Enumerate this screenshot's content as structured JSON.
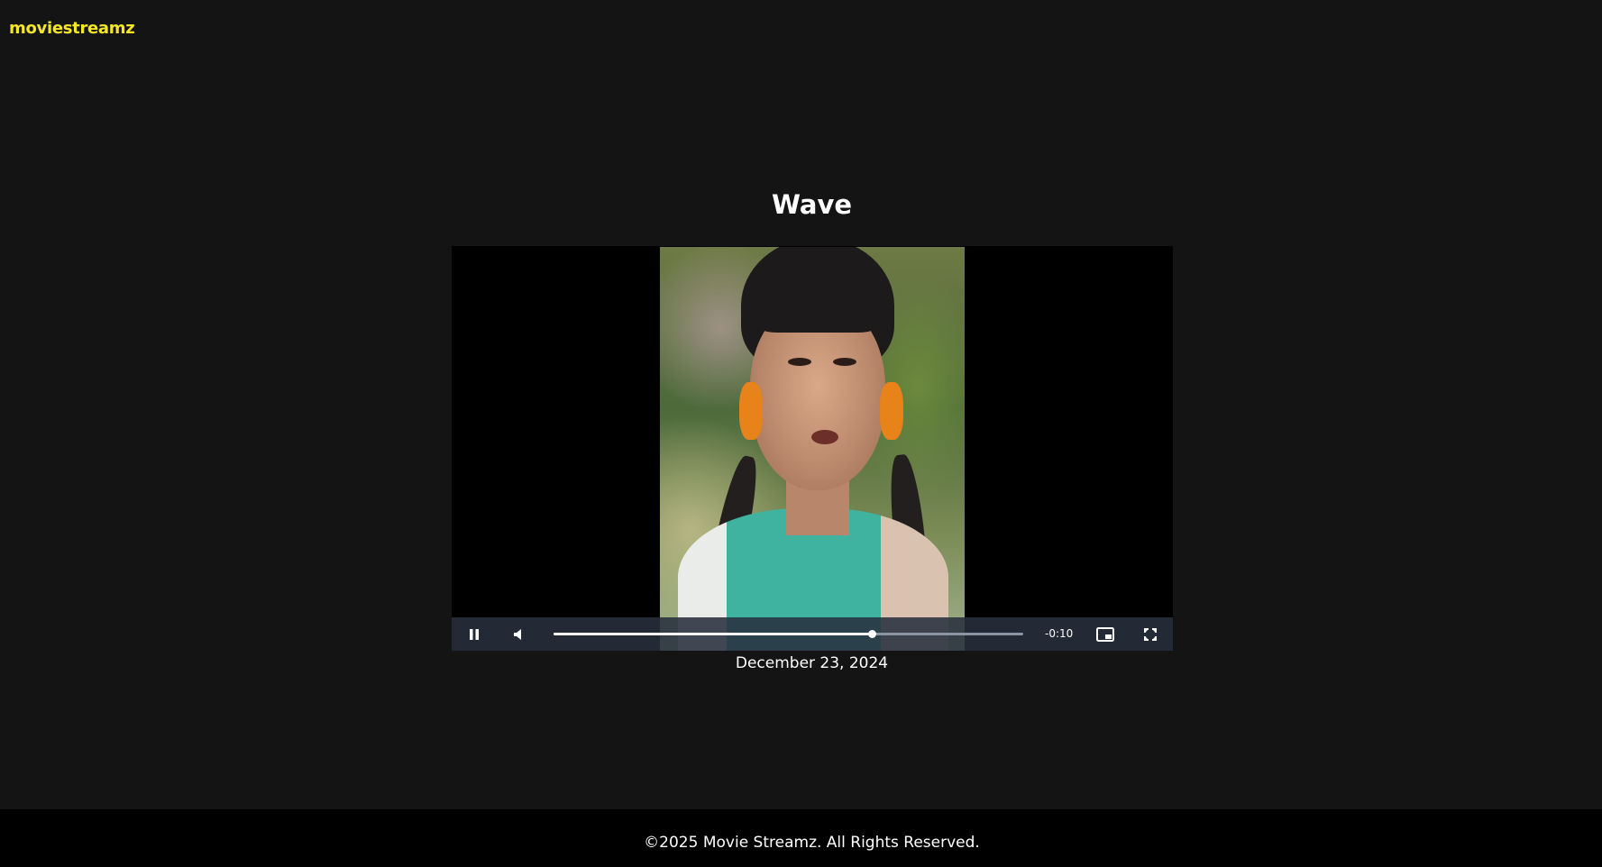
{
  "header": {
    "logo_text": "moviestreamz"
  },
  "movie": {
    "title": "Wave",
    "release_date": "December 23, 2024"
  },
  "player": {
    "state": "playing",
    "muted": true,
    "progress_fraction": 0.677,
    "time_remaining": "-0:10",
    "icons": {
      "play_pause": "pause-icon",
      "volume": "volume-muted-icon",
      "pip": "picture-in-picture-icon",
      "fullscreen": "fullscreen-icon"
    }
  },
  "footer": {
    "copyright": "©2025 Movie Streamz. All Rights Reserved."
  },
  "colors": {
    "background": "#141414",
    "footer_background": "#000000",
    "logo_accent": "#f5e625",
    "controls_bar": "#28303e"
  }
}
